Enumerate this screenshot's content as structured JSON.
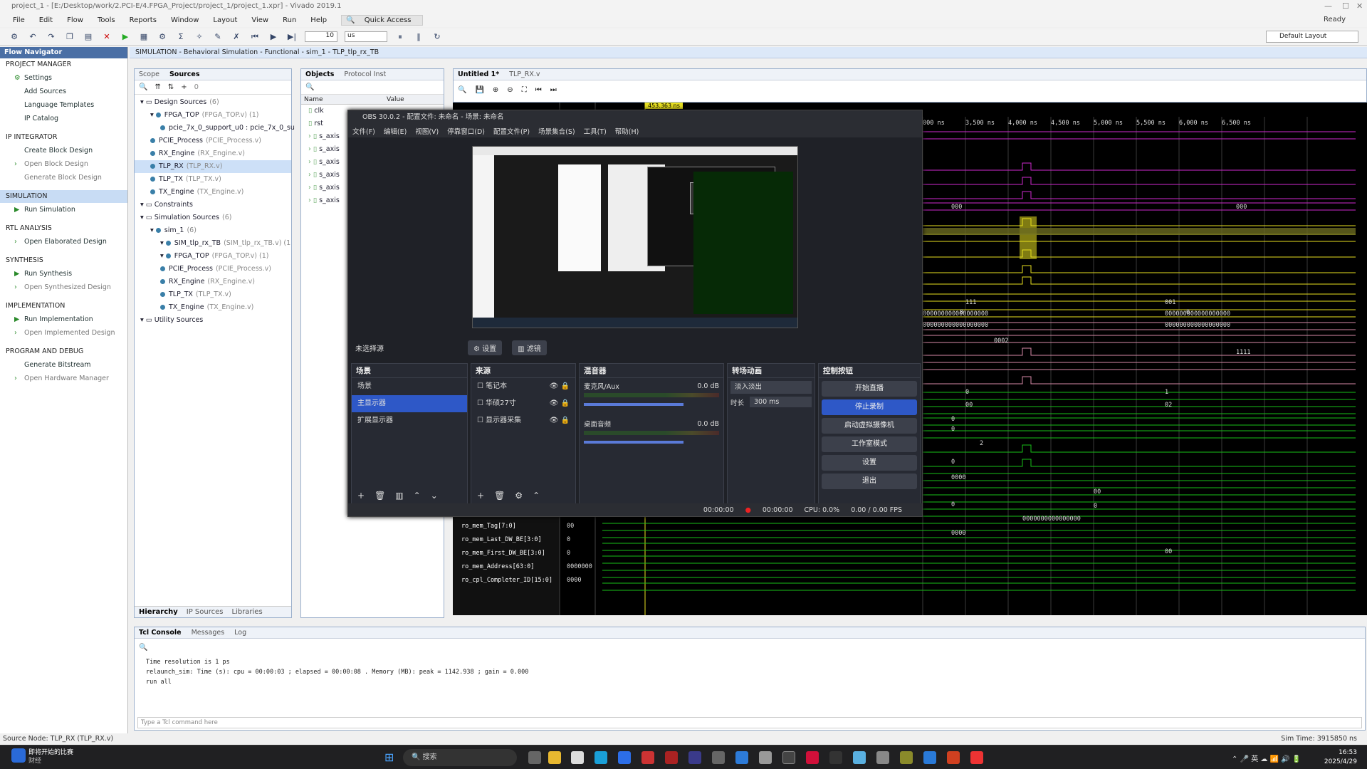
{
  "window": {
    "title": "project_1 - [E:/Desktop/work/2.PCI-E/4.FPGA_Project/project_1/project_1.xpr] - Vivado 2019.1",
    "status": "Ready"
  },
  "menu": [
    "File",
    "Edit",
    "Flow",
    "Tools",
    "Reports",
    "Window",
    "Layout",
    "View",
    "Run",
    "Help"
  ],
  "quick_access": "Quick Access",
  "toolbar": {
    "time_value": "10",
    "time_unit": "us"
  },
  "layout": "Default Layout",
  "flow_nav": {
    "title": "Flow Navigator",
    "sections": [
      {
        "label": "PROJECT MANAGER",
        "items": [
          "Settings",
          "Add Sources",
          "Language Templates",
          "IP Catalog"
        ]
      },
      {
        "label": "IP INTEGRATOR",
        "items": [
          "Create Block Design",
          "Open Block Design",
          "Generate Block Design"
        ]
      },
      {
        "label": "SIMULATION",
        "items": [
          "Run Simulation"
        ]
      },
      {
        "label": "RTL ANALYSIS",
        "items": [
          "Open Elaborated Design"
        ]
      },
      {
        "label": "SYNTHESIS",
        "items": [
          "Run Synthesis",
          "Open Synthesized Design"
        ]
      },
      {
        "label": "IMPLEMENTATION",
        "items": [
          "Run Implementation",
          "Open Implemented Design"
        ]
      },
      {
        "label": "PROGRAM AND DEBUG",
        "items": [
          "Generate Bitstream",
          "Open Hardware Manager"
        ]
      }
    ]
  },
  "sim_header": "SIMULATION - Behavioral Simulation - Functional - sim_1 - TLP_tlp_rx_TB",
  "sources": {
    "tabs": [
      "Scope",
      "Sources"
    ],
    "count": "0",
    "tree": [
      {
        "t": "Design Sources",
        "g": "(6)",
        "lvl": 0
      },
      {
        "t": "FPGA_TOP",
        "g": "(FPGA_TOP.v) (1)",
        "lvl": 1
      },
      {
        "t": "pcie_7x_0_support_u0 : pcie_7x_0_su",
        "g": "",
        "lvl": 2
      },
      {
        "t": "PCIE_Process",
        "g": "(PCIE_Process.v)",
        "lvl": 1
      },
      {
        "t": "RX_Engine",
        "g": "(RX_Engine.v)",
        "lvl": 1
      },
      {
        "t": "TLP_RX",
        "g": "(TLP_RX.v)",
        "lvl": 1
      },
      {
        "t": "TLP_TX",
        "g": "(TLP_TX.v)",
        "lvl": 1
      },
      {
        "t": "TX_Engine",
        "g": "(TX_Engine.v)",
        "lvl": 1
      },
      {
        "t": "Constraints",
        "g": "",
        "lvl": 0
      },
      {
        "t": "Simulation Sources",
        "g": "(6)",
        "lvl": 0
      },
      {
        "t": "sim_1",
        "g": "(6)",
        "lvl": 1
      },
      {
        "t": "SIM_tlp_rx_TB",
        "g": "(SIM_tlp_rx_TB.v) (1",
        "lvl": 2
      },
      {
        "t": "FPGA_TOP",
        "g": "(FPGA_TOP.v) (1)",
        "lvl": 2
      },
      {
        "t": "PCIE_Process",
        "g": "(PCIE_Process.v)",
        "lvl": 2
      },
      {
        "t": "RX_Engine",
        "g": "(RX_Engine.v)",
        "lvl": 2
      },
      {
        "t": "TLP_TX",
        "g": "(TLP_TX.v)",
        "lvl": 2
      },
      {
        "t": "TX_Engine",
        "g": "(TX_Engine.v)",
        "lvl": 2
      },
      {
        "t": "Utility Sources",
        "g": "",
        "lvl": 0
      }
    ],
    "bottom_tabs": [
      "Hierarchy",
      "IP Sources",
      "Libraries"
    ]
  },
  "objects": {
    "tabs": [
      "Objects",
      "Protocol Inst"
    ],
    "cols": [
      "Name",
      "Value"
    ],
    "rows": [
      "clk",
      "rst",
      "s_axis",
      "s_axis",
      "s_axis",
      "s_axis",
      "s_axis",
      "s_axis"
    ]
  },
  "wave": {
    "tabs": [
      "Untitled 1*",
      "TLP_RX.v"
    ],
    "cursor": "453.363 ns",
    "ticks": [
      "000 ns",
      "3,500 ns",
      "4,000 ns",
      "4,500 ns",
      "5,000 ns",
      "5,500 ns",
      "6,000 ns",
      "6,500 ns"
    ],
    "signals": [
      "ro_mem_Tag[7:0]",
      "ro_mem_Last_DW_BE[3:0]",
      "ro_mem_First_DW_BE[3:0]",
      "ro_mem_Address[63:0]",
      "ro_cpl_Completer_ID[15:0]"
    ],
    "sigvals": [
      "00",
      "0",
      "0",
      "0000000",
      "0000"
    ],
    "labels": [
      "000",
      "000",
      "111",
      "001",
      "0",
      "0",
      "000000000000000000",
      "000000000000000000",
      "000000000000000000",
      "000000000000000000",
      "0002",
      "1111",
      "0",
      "1",
      "00",
      "02",
      "0",
      "0",
      "2",
      "0",
      "0000",
      "00",
      "0",
      "0",
      "0000000000000000",
      "0000",
      "00"
    ]
  },
  "obs": {
    "title": "OBS 30.0.2 - 配置文件: 未命名 - 场景: 未命名",
    "menu": [
      "文件(F)",
      "编辑(E)",
      "视图(V)",
      "停靠窗口(D)",
      "配置文件(P)",
      "场景集合(S)",
      "工具(T)",
      "帮助(H)"
    ],
    "no_source": "未选择源",
    "settings_btn": "设置",
    "filter_btn": "滤镜",
    "scenes": {
      "title": "场景",
      "items": [
        "场景",
        "主显示器",
        "扩展显示器"
      ]
    },
    "sources": {
      "title": "来源",
      "items": [
        "笔记本",
        "华硕27寸",
        "显示器采集"
      ]
    },
    "mixer": {
      "title": "混音器",
      "ch1": "麦克风/Aux",
      "ch1db": "0.0 dB",
      "ch2": "桌面音频",
      "ch2db": "0.0 dB"
    },
    "transition": {
      "title": "转场动画",
      "type": "淡入淡出",
      "dur_label": "时长",
      "dur": "300 ms"
    },
    "controls": {
      "title": "控制按钮",
      "items": [
        "开始直播",
        "停止录制",
        "启动虚拟摄像机",
        "工作室模式",
        "设置",
        "退出"
      ]
    },
    "status": {
      "stream": "00:00:00",
      "rec": "00:00:00",
      "cpu": "CPU: 0.0%",
      "fps": "0.00 / 0.00 FPS"
    }
  },
  "tcl": {
    "tabs": [
      "Tcl Console",
      "Messages",
      "Log"
    ],
    "lines": [
      "Time resolution is 1 ps",
      "relaunch_sim: Time (s): cpu = 00:00:03 ; elapsed = 00:00:08 . Memory (MB): peak = 1142.938 ; gain = 0.000",
      "run all"
    ],
    "placeholder": "Type a Tcl command here"
  },
  "statusbar": {
    "left": "Source Node: TLP_RX (TLP_RX.v)",
    "right": "Sim Time: 3915850 ns"
  },
  "taskbar": {
    "weather1": "即将开始的比赛",
    "weather2": "财经",
    "search": "搜索",
    "time": "16:53",
    "date": "2025/4/29",
    "lang": "英"
  },
  "colors": {
    "accent": "#2e58c7",
    "green": "#19c019",
    "magenta": "#d02ad0",
    "yellow": "#e8e020"
  }
}
